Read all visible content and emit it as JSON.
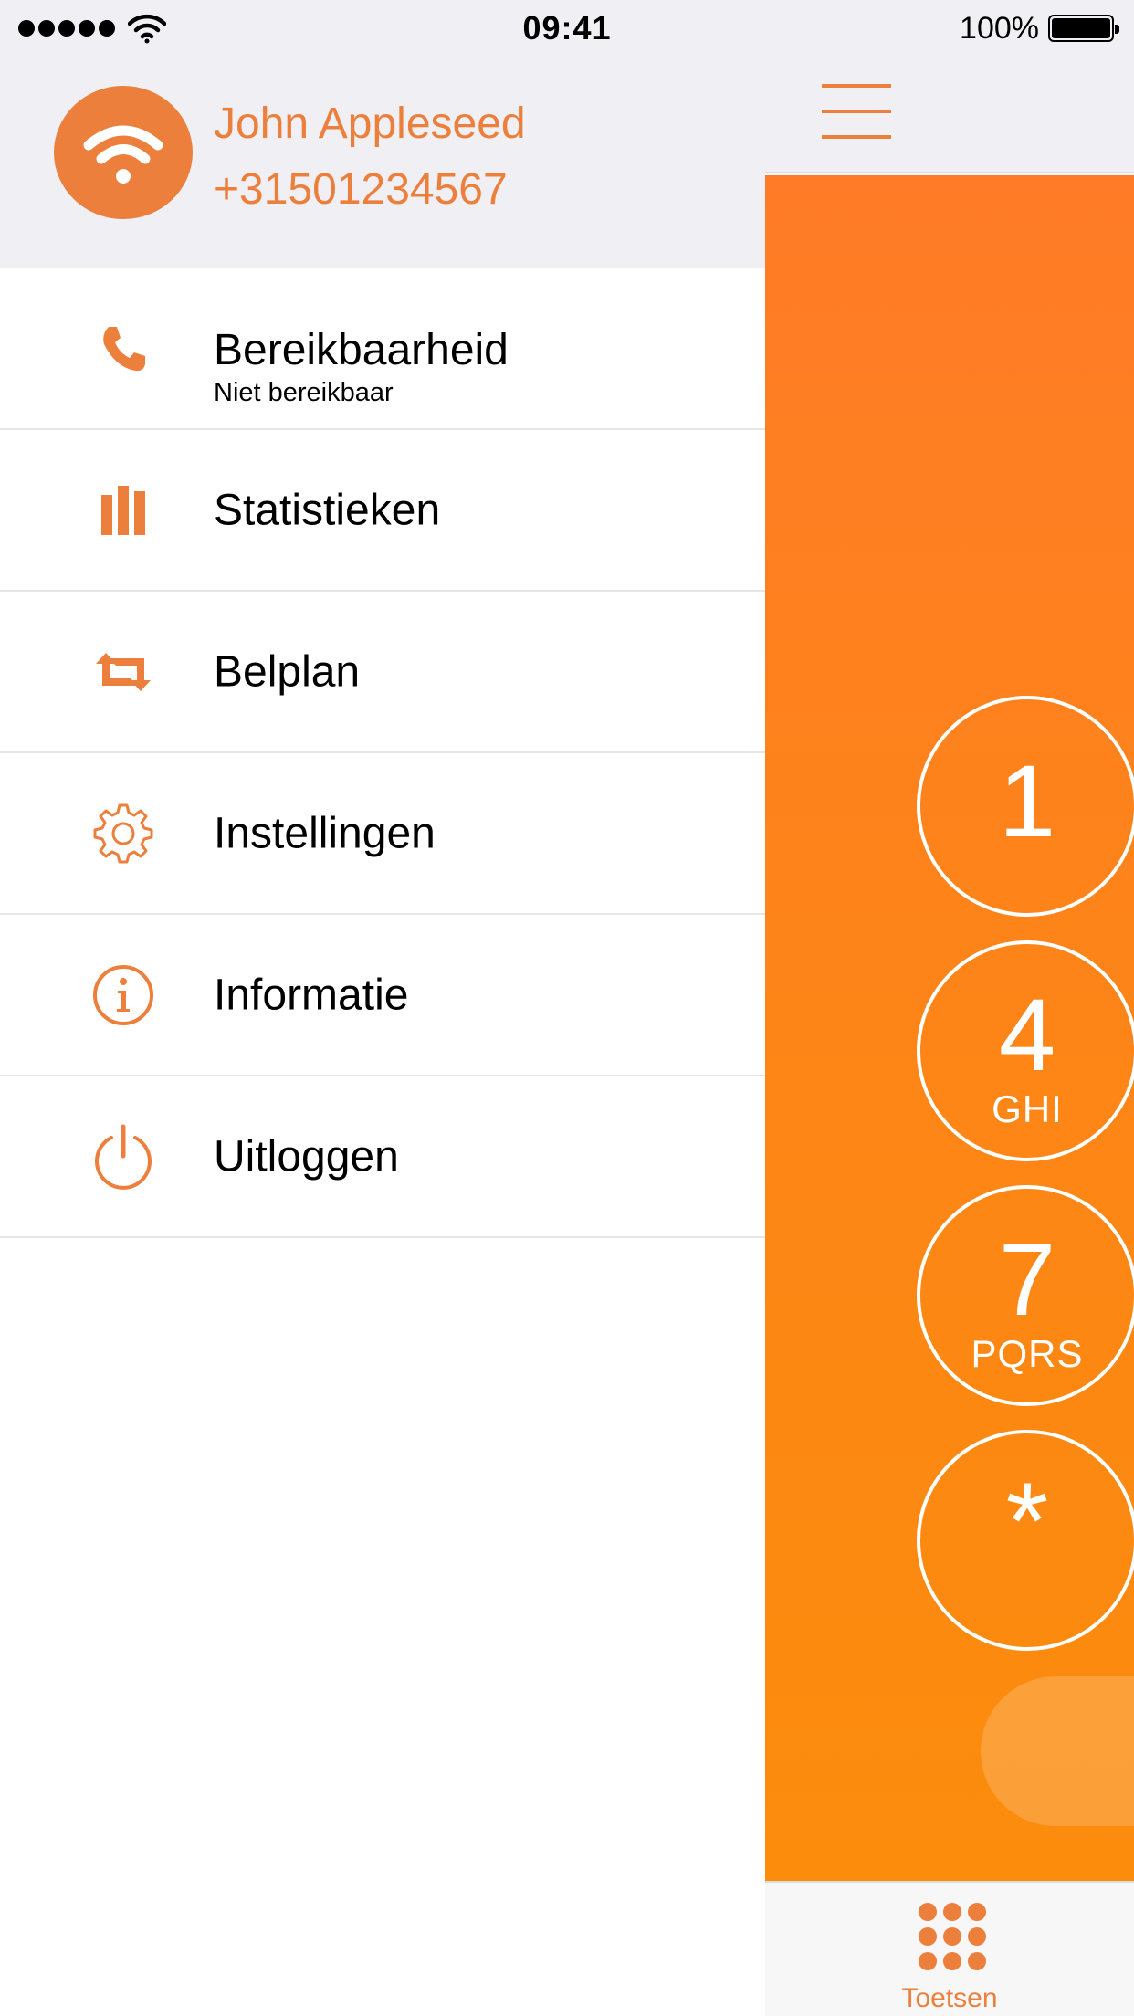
{
  "status_bar": {
    "time": "09:41",
    "battery": "100%",
    "signal_icon": "signal-dots-icon",
    "wifi_icon": "wifi-icon",
    "battery_icon": "battery-icon"
  },
  "profile": {
    "name": "John Appleseed",
    "number": "+31501234567",
    "avatar_icon": "phone-wifi-icon"
  },
  "menu": {
    "items": [
      {
        "label": "Bereikbaarheid",
        "sub": "Niet bereikbaar",
        "icon": "phone-icon"
      },
      {
        "label": "Statistieken",
        "icon": "bar-chart-icon"
      },
      {
        "label": "Belplan",
        "icon": "repeat-icon"
      },
      {
        "label": "Instellingen",
        "icon": "gear-icon"
      },
      {
        "label": "Informatie",
        "icon": "info-icon"
      },
      {
        "label": "Uitloggen",
        "icon": "power-icon"
      }
    ]
  },
  "dialer": {
    "menu_icon": "hamburger-icon",
    "keys": [
      {
        "digit": "1",
        "letters": ""
      },
      {
        "digit": "4",
        "letters": "GHI"
      },
      {
        "digit": "7",
        "letters": "PQRS"
      },
      {
        "digit": "*",
        "letters": ""
      }
    ]
  },
  "tabbar": {
    "tab_label": "Toetsen",
    "tab_icon": "keypad-icon"
  },
  "colors": {
    "accent": "#ec7f3c",
    "dialer_top": "#ff7b27",
    "dialer_bottom": "#fb8c0c",
    "header_bg": "#efeff4"
  }
}
